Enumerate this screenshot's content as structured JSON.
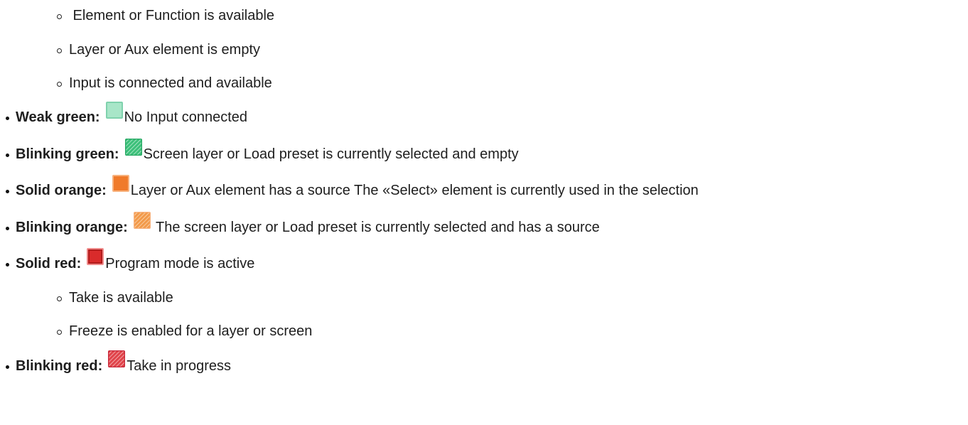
{
  "items": [
    {
      "level": 2,
      "text": " Element or Function is available"
    },
    {
      "level": 2,
      "text": "Layer or Aux element is empty"
    },
    {
      "level": 2,
      "text": "Input is connected and available"
    },
    {
      "level": 1,
      "label": "Weak green:",
      "swatch": "weak-green",
      "text": "No Input connected"
    },
    {
      "level": 1,
      "label": "Blinking green:",
      "swatch": "blinking-green",
      "text": "Screen layer or Load preset is currently selected and empty"
    },
    {
      "level": 1,
      "label": "Solid orange:",
      "swatch": "solid-orange",
      "text": "Layer or Aux element has a source The «Select» element is currently used in the selection"
    },
    {
      "level": 1,
      "label": "Blinking orange:",
      "swatch": "blinking-orange",
      "text": " The screen layer or Load preset is currently selected and has a source"
    },
    {
      "level": 1,
      "label": "Solid red:",
      "swatch": "solid-red",
      "text": "Program mode is active"
    },
    {
      "level": 2,
      "text": "Take is available"
    },
    {
      "level": 2,
      "text": "Freeze is enabled for a layer or screen"
    },
    {
      "level": 1,
      "label": "Blinking red:",
      "swatch": "blinking-red",
      "text": "Take in progress"
    }
  ],
  "colors": {
    "weak_green_fill": "#a8e6c8",
    "weak_green_border": "#7fd2ad",
    "blinking_green": "#3cc07a",
    "solid_orange": "#f07a2a",
    "blinking_orange": "#f29a4a",
    "solid_red": "#d92b2b",
    "blinking_red": "#e0444a"
  }
}
